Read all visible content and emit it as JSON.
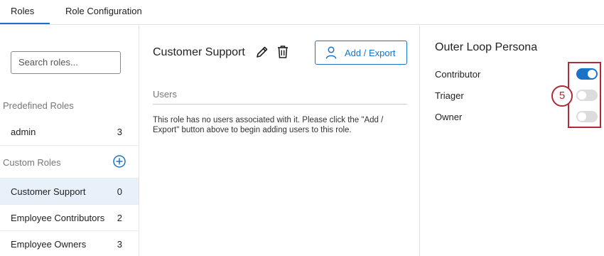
{
  "tabs": [
    {
      "label": "Roles",
      "active": true
    },
    {
      "label": "Role Configuration",
      "active": false
    }
  ],
  "sidebar": {
    "search_placeholder": "Search roles...",
    "predefined_label": "Predefined Roles",
    "predefined_roles": [
      {
        "label": "admin",
        "count": "3"
      }
    ],
    "custom_label": "Custom Roles",
    "custom_roles": [
      {
        "label": "Customer Support",
        "count": "0",
        "selected": true
      },
      {
        "label": "Employee Contributors",
        "count": "2",
        "selected": false
      },
      {
        "label": "Employee Owners",
        "count": "3",
        "selected": false
      }
    ]
  },
  "role": {
    "title": "Customer Support",
    "add_export_label": "Add / Export",
    "users_label": "Users",
    "empty_message": "This role has no users associated with it. Please click the \"Add / Export\" button above to begin adding users to this role."
  },
  "persona": {
    "title": "Outer Loop Persona",
    "options": [
      {
        "label": "Contributor",
        "enabled": true
      },
      {
        "label": "Triager",
        "enabled": false
      },
      {
        "label": "Owner",
        "enabled": false
      }
    ]
  },
  "annotation": {
    "step_number": "5",
    "color": "#b02a37"
  },
  "colors": {
    "accent": "#1a73c8",
    "selected_row_bg": "#e8f0fa"
  },
  "icons": [
    "pencil-icon",
    "trash-icon",
    "person-icon",
    "plus-circle-icon"
  ]
}
